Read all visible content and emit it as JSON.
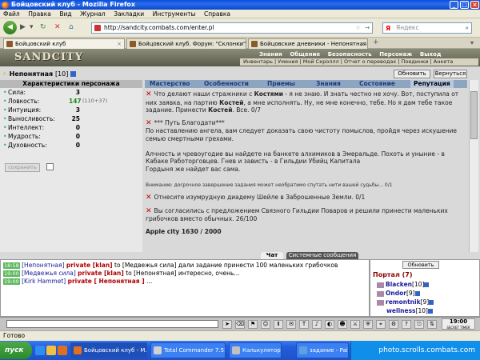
{
  "window": {
    "title": "Бойцовский клуб - Mozilla Firefox"
  },
  "menu": [
    "Файл",
    "Правка",
    "Вид",
    "Журнал",
    "Закладки",
    "Инструменты",
    "Справка"
  ],
  "nav": {
    "url": "http://sandcity.combats.com/enter.pl",
    "search_placeholder": "Яндекс",
    "search_logo": "Я"
  },
  "tabs": [
    {
      "label": "Бойцовский клуб",
      "active": true
    },
    {
      "label": "Бойцовский клуб. Форум: \"Склонки\"",
      "active": false
    },
    {
      "label": "Бойцовские дневники - Непонятная",
      "active": false
    }
  ],
  "game": {
    "logo": "SANDCITY",
    "top_menu": [
      "Знания",
      "Общение",
      "Безопасность",
      "Персонаж",
      "Выход"
    ],
    "sub_menu": "Инвентарь | Умения | Мой Скроллл | Отчет о переводах | Поединки | Анкета",
    "character": {
      "name": "Непонятная",
      "level": "[10]"
    },
    "buttons": {
      "refresh": "Обновить",
      "back": "Вернуться",
      "save": "сохранить"
    },
    "stats_title": "Характеристики персонажа",
    "stats": [
      {
        "label": "Сила:",
        "value": "3",
        "extra": ""
      },
      {
        "label": "Ловкость:",
        "value": "147",
        "extra": "(110+37)"
      },
      {
        "label": "Интуиция:",
        "value": "3",
        "extra": ""
      },
      {
        "label": "Выносливость:",
        "value": "25",
        "extra": ""
      },
      {
        "label": "Интеллект:",
        "value": "0",
        "extra": ""
      },
      {
        "label": "Мудрость:",
        "value": "0",
        "extra": ""
      },
      {
        "label": "Духовность:",
        "value": "0",
        "extra": ""
      }
    ],
    "quest_tabs": [
      "Мастерство",
      "Особенности",
      "Приемы",
      "Знания",
      "Состояние",
      "Репутация"
    ],
    "quests": {
      "q1": {
        "t1": "Что делают наши стражники с ",
        "b1": "Костями",
        "t2": " - я не знаю. И знать честно не хочу. Вот, поступила от них заявка, на партию ",
        "b2": "Костей",
        "t3": ", а мне исполнять. Ну, не мне конечно, тебе. Но я дам тебе такое задание. Принести ",
        "b3": "Костей",
        "t4": ". Все. 0/7"
      },
      "q2": {
        "title": "*** Путь Благодати***",
        "p1": "По наставлению ангела, вам следует доказать свою чистоту помыслов, пройдя через искушение семью смертными грехами.",
        "p2": "Алчность и чревоугодие вы найдете на банкете алхимиков в Эмеральде. Похоть и уныние - в Кабаке Работорговцев. Гнев и зависть - в Гильдии Убийц Капитала",
        "p3": "Гордыня же найдет вас сама.",
        "note": "Внимание: досрочное завершение задания может необратимо спутать нити вашей судьбы... 0/1"
      },
      "q3": "Отнесите изумрудную диадему Шейле в Заброшенные Земли. 0/1",
      "q4": "Вы согласились с предложением Связного Гильдии Поваров и решили принести маленьких грибочков вместо обычных. 26/100",
      "cut": "Apple city 1630 / 2000"
    }
  },
  "chat": {
    "tabs": [
      "Чат",
      "Системные сообщения"
    ],
    "lines": [
      {
        "time": "18:58",
        "from": "[Непонятная]",
        "pv": "private [klan]",
        "text": "to [Медвежья сила] дали задание принести 100 маленьких грибочков"
      },
      {
        "time": "19:00",
        "from": "[Медвежья сила]",
        "pv": "private [klan]",
        "text": "to [Непонятная] интересно, очень..."
      },
      {
        "time": "19:00",
        "from": "[Kirk Hammet]",
        "pv": "private [ Непонятная ]",
        "text": "..."
      }
    ]
  },
  "portal": {
    "refresh": "Обновить",
    "title": "Портал (7)",
    "users": [
      {
        "name": "Blacken",
        "level": "[10]"
      },
      {
        "name": "Ondor",
        "level": "[9]"
      },
      {
        "name": "remontnik",
        "level": "[9]"
      },
      {
        "name": "wellness",
        "level": "[10]"
      }
    ]
  },
  "toolbar": {
    "time": "19:00",
    "time_sub": "SECRET TIMER"
  },
  "status": "Готово",
  "taskbar": {
    "start": "пуск",
    "tasks": [
      "Бойцовский клуб - М...",
      "Total Commander 7.55 - ...",
      "Калькулятор",
      "задание - Paint"
    ],
    "watermark": "photo.scrolls.combats.com"
  }
}
